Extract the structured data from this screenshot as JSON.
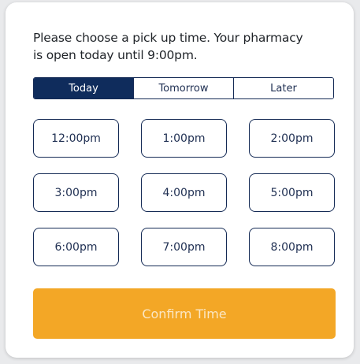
{
  "prompt": {
    "line1": "Please choose a pick up time. Your pharmacy",
    "line2": "is open today until 9:00pm."
  },
  "tabs": [
    {
      "label": "Today",
      "active": true
    },
    {
      "label": "Tomorrow",
      "active": false
    },
    {
      "label": "Later",
      "active": false
    }
  ],
  "slots": [
    "12:00pm",
    "1:00pm",
    "2:00pm",
    "3:00pm",
    "4:00pm",
    "5:00pm",
    "6:00pm",
    "7:00pm",
    "8:00pm"
  ],
  "confirm": {
    "label": "Confirm Time"
  },
  "colors": {
    "navy": "#0f2c5c",
    "accent_orange": "#f3a726",
    "card_bg": "#ffffff"
  }
}
